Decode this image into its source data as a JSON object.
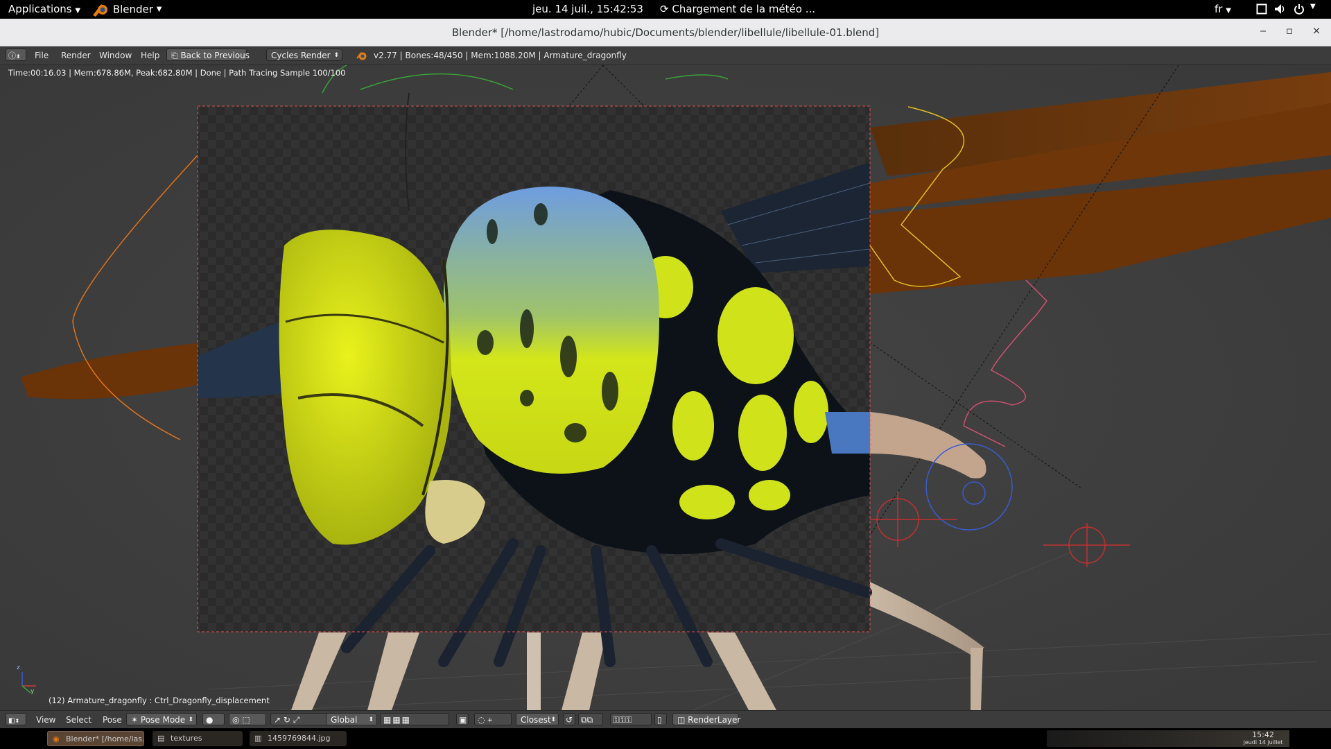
{
  "topbar": {
    "applications_label": "Applications",
    "app_label": "Blender",
    "clock": "jeu. 14 juil., 15:42:53",
    "weather": "Chargement de la météo ...",
    "language": "fr"
  },
  "window": {
    "title": "Blender* [/home/lastrodamo/hubic/Documents/blender/libellule/libellule-01.blend]",
    "minimize": "‒",
    "maximize": "▫",
    "close": "×"
  },
  "info_header": {
    "menus": [
      "File",
      "Render",
      "Window",
      "Help"
    ],
    "back_button": "Back to Previous",
    "render_engine": "Cycles Render",
    "scene_stats": "v2.77 | Bones:48/450 | Mem:1088.20M | Armature_dragonfly"
  },
  "viewport": {
    "render_stats": "Time:00:16.03 | Mem:678.86M, Peak:682.80M | Done | Path Tracing Sample 100/100",
    "object_info": "(12) Armature_dragonfly : Ctrl_Dragonfly_displacement",
    "axis_z": "z",
    "axis_y": "y"
  },
  "view_header": {
    "menus": [
      "View",
      "Select",
      "Pose"
    ],
    "mode": "Pose Mode",
    "orientation": "Global",
    "snap_target": "Closest",
    "render_layer": "RenderLayer"
  },
  "taskbar": {
    "tasks": [
      "Blender* [/home/las...",
      "textures",
      "1459769844.jpg"
    ],
    "time": "15:42",
    "date": "jeudi 14 juillet"
  },
  "colors": {
    "viewport_bg": "#3d3d3d",
    "header_bg": "#3c3c3c",
    "accent_blender": "#e87d0d",
    "render_border": "#ff5555"
  }
}
